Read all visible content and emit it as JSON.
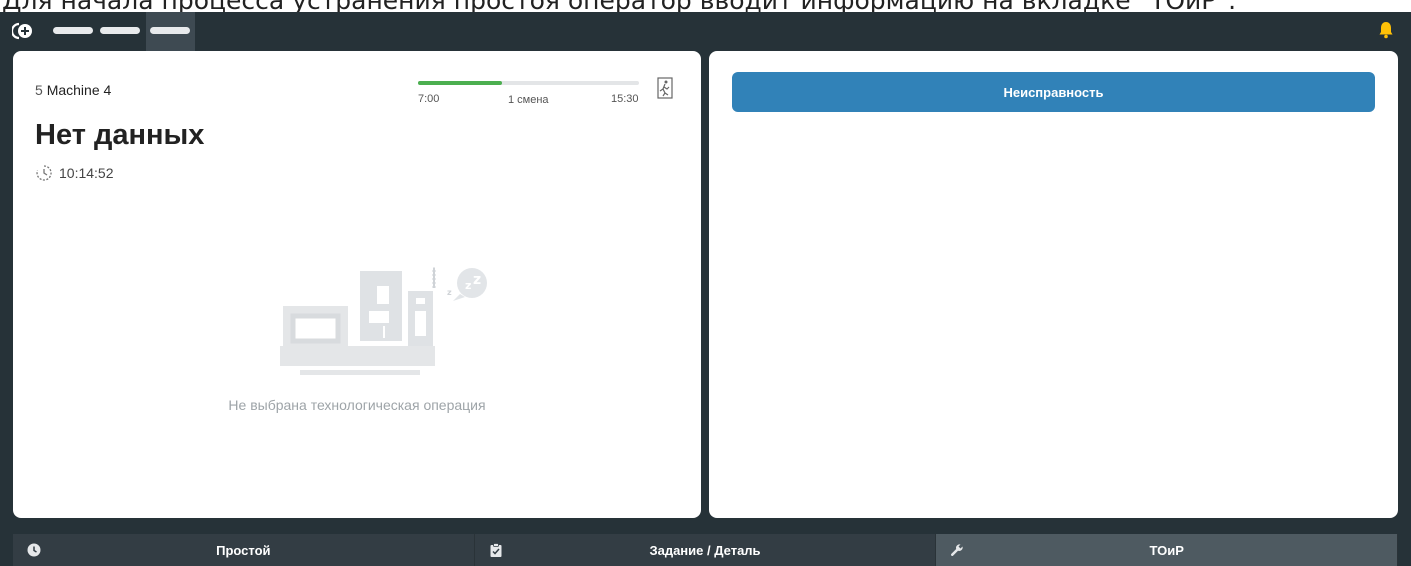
{
  "caption": "Для начала процесса устранения простоя оператор вводит информацию на вкладке \"ТОиР\":",
  "colors": {
    "background": "#263238",
    "panel": "#ffffff",
    "accent": "#3182b8",
    "progress": "#4caf50",
    "bell": "#ffc107",
    "active_tab": "#4e5a61"
  },
  "topbar": {
    "icons": [
      "add-circle-icon",
      "bell-icon"
    ]
  },
  "machine": {
    "number": "5",
    "name": "Machine 4"
  },
  "status": {
    "title": "Нет данных",
    "time": "10:14:52"
  },
  "shift": {
    "start": "7:00",
    "name": "1 смена",
    "end": "15:30",
    "progress": 0.38
  },
  "empty_state": {
    "message": "Не выбрана технологическая операция",
    "icon": "sleeping-machine-icon"
  },
  "right_panel": {
    "fault_button_label": "Неисправность"
  },
  "bottom_tabs": [
    {
      "label": "Простой",
      "icon": "clock-icon"
    },
    {
      "label": "Задание / Деталь",
      "icon": "clipboard-check-icon"
    },
    {
      "label": "ТОиР",
      "icon": "wrench-icon",
      "active": true
    }
  ]
}
